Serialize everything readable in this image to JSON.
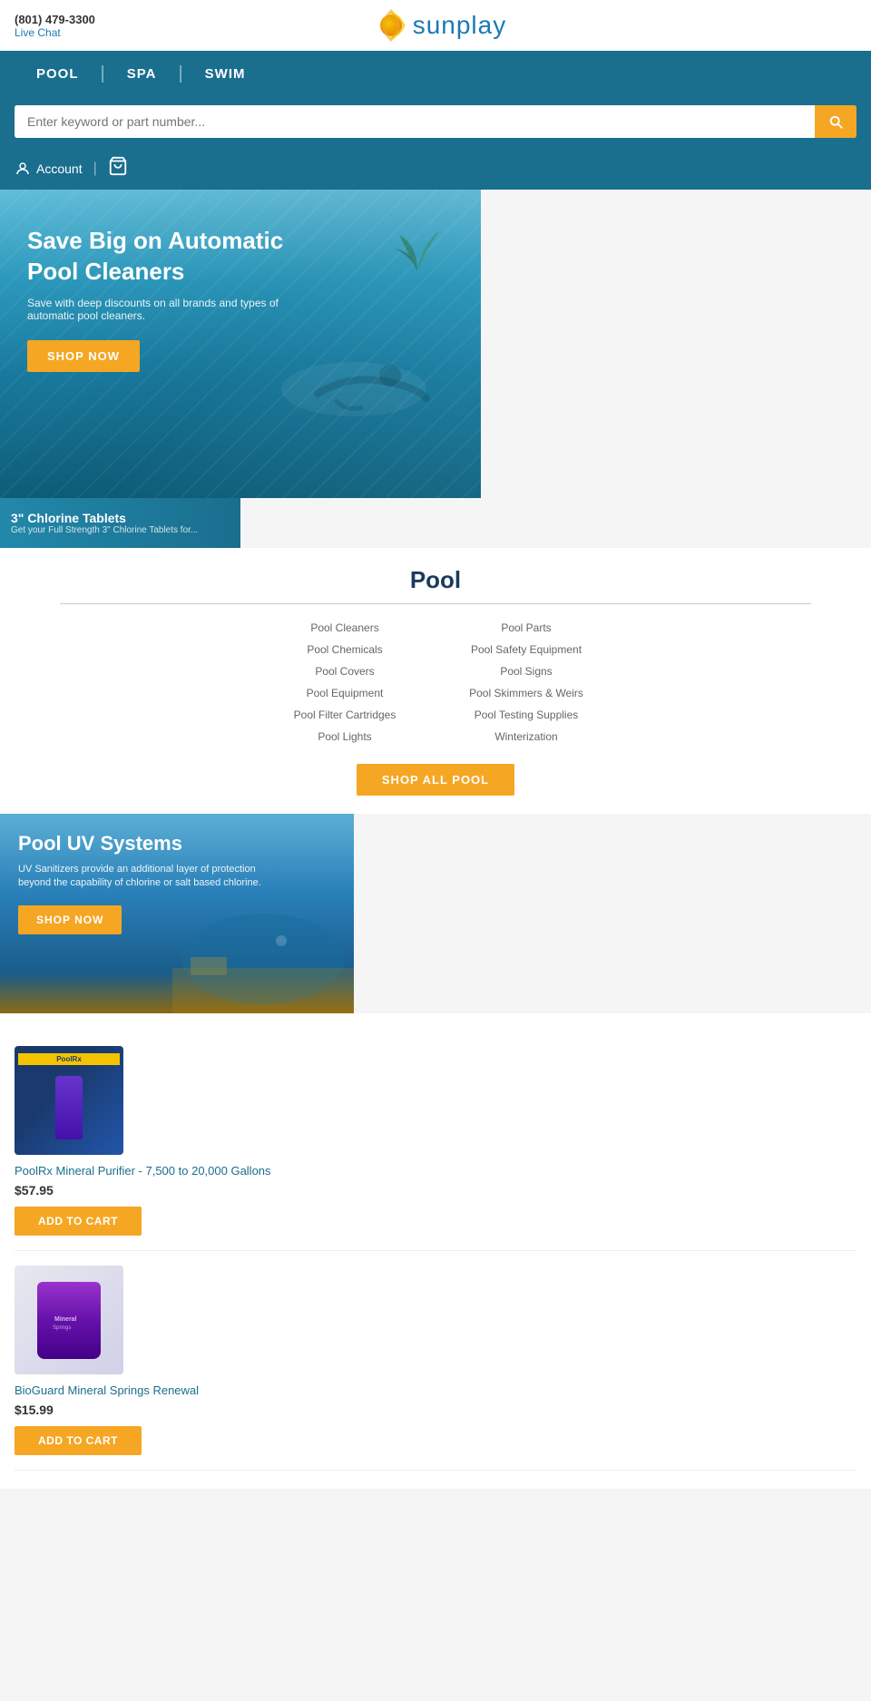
{
  "topbar": {
    "phone": "(801) 479-3300",
    "live_chat": "Live Chat"
  },
  "logo": {
    "text": "sunplay"
  },
  "nav": {
    "items": [
      {
        "label": "POOL"
      },
      {
        "label": "SPA"
      },
      {
        "label": "SWIM"
      }
    ]
  },
  "search": {
    "placeholder": "Enter keyword or part number..."
  },
  "account": {
    "label": "Account"
  },
  "hero": {
    "title": "Save Big on Automatic Pool Cleaners",
    "subtitle": "Save with deep discounts on all brands and types of automatic pool cleaners.",
    "button": "SHOP NOW"
  },
  "chlorine_banner": {
    "title": "3\" Chlorine Tablets",
    "subtitle": "Get your Full Strength 3\" Chlorine Tablets for..."
  },
  "pool_section": {
    "title": "Pool",
    "links": [
      "Pool Cleaners",
      "Pool Parts",
      "Pool Chemicals",
      "Pool Safety Equipment",
      "Pool Covers",
      "Pool Signs",
      "Pool Equipment",
      "Pool Skimmers & Weirs",
      "Pool Filter Cartridges",
      "Pool Testing Supplies",
      "Pool Lights",
      "Winterization"
    ],
    "shop_all_button": "SHOP ALL POOL"
  },
  "uv_banner": {
    "title": "Pool UV Systems",
    "subtitle": "UV Sanitizers provide an additional layer of protection beyond the capability of chlorine or salt based chlorine.",
    "button": "SHOP NOW"
  },
  "products": [
    {
      "name": "PoolRx Mineral Purifier - 7,500 to 20,000 Gallons",
      "price": "$57.95",
      "add_to_cart": "ADD TO CART",
      "type": "poolrx"
    },
    {
      "name": "BioGuard Mineral Springs Renewal",
      "price": "$15.99",
      "add_to_cart": "ADD TO CART",
      "type": "bioguard"
    }
  ]
}
